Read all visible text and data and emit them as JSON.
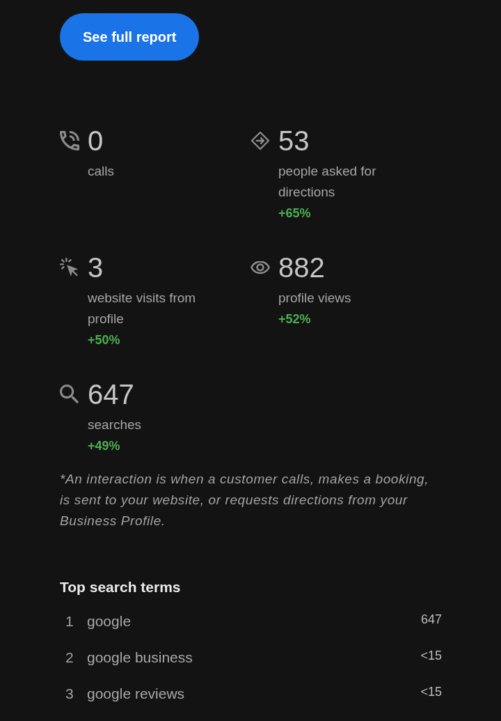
{
  "report_button": {
    "label": "See full report"
  },
  "metrics": [
    {
      "kind": "calls",
      "value": "0",
      "label": "calls"
    },
    {
      "kind": "directions",
      "value": "53",
      "label": "people asked for directions",
      "change": "+65%"
    },
    {
      "kind": "website",
      "value": "3",
      "label": "website visits from profile",
      "change": "+50%"
    },
    {
      "kind": "views",
      "value": "882",
      "label": "profile views",
      "change": "+52%"
    },
    {
      "kind": "searches",
      "value": "647",
      "label": "searches",
      "change": "+49%"
    }
  ],
  "footnote": "*An interaction is when a customer calls, makes a booking, is sent to your website, or requests directions from your Business Profile.",
  "top_search_terms": {
    "title": "Top search terms",
    "rows": [
      {
        "rank": "1",
        "term": "google",
        "count": "647"
      },
      {
        "rank": "2",
        "term": "google business",
        "count": "<15"
      },
      {
        "rank": "3",
        "term": "google reviews",
        "count": "<15"
      }
    ]
  }
}
